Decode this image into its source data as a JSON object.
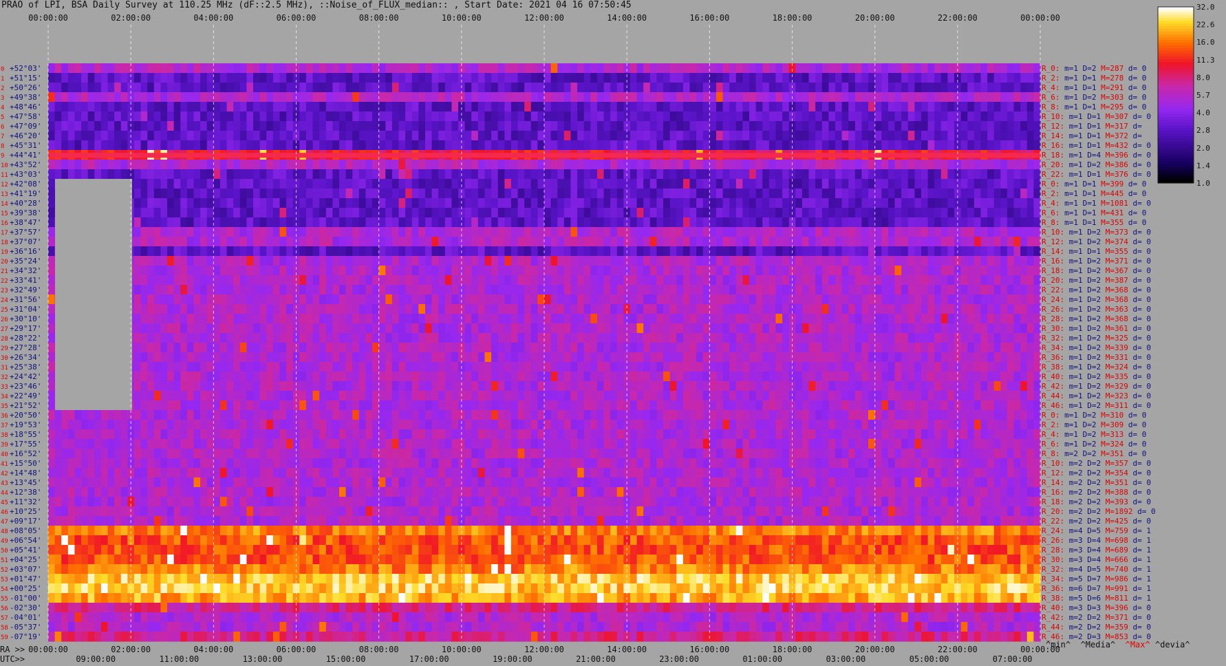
{
  "title": "PRAO of LPI, BSA Daily Survey at 110.25 MHz (dF::2.5 MHz), ::Noise_of_FLUX_median:: , Start Date: 2021 04 16 07:50:45",
  "colors": {
    "background": "#a5a5a5",
    "beam_label": "#e00000",
    "dec_label": "#101080",
    "stat_label": "#101080"
  },
  "legend_bottom": {
    "min": "^min^",
    "median": "^Media^",
    "max": "^Max^",
    "dev": "^devia^"
  },
  "ra_prefix": "RA >>",
  "utc_prefix": "UTC>>",
  "chart_data": {
    "type": "heatmap",
    "title": "PRAO of LPI, BSA Daily Survey at 110.25 MHz (dF::2.5 MHz), ::Noise_of_FLUX_median:: , Start Date: 2021 04 16 07:50:45",
    "x_top_ticks": [
      "00:00:00",
      "02:00:00",
      "04:00:00",
      "06:00:00",
      "08:00:00",
      "10:00:00",
      "12:00:00",
      "14:00:00",
      "16:00:00",
      "18:00:00",
      "20:00:00",
      "22:00:00",
      "00:00:00"
    ],
    "ra_ticks": [
      "00:00:00",
      "02:00:00",
      "04:00:00",
      "06:00:00",
      "08:00:00",
      "10:00:00",
      "12:00:00",
      "14:00:00",
      "16:00:00",
      "18:00:00",
      "20:00:00",
      "22:00:00",
      "00:00:00"
    ],
    "utc_ticks": [
      "09:00:00",
      "11:00:00",
      "13:00:00",
      "15:00:00",
      "17:00:00",
      "19:00:00",
      "21:00:00",
      "23:00:00",
      "01:00:00",
      "03:00:00",
      "05:00:00",
      "07:00:00"
    ],
    "colorbar": {
      "ticks": [
        32.0,
        22.6,
        16.0,
        11.3,
        8.0,
        5.7,
        4.0,
        2.8,
        2.0,
        1.4,
        1.0
      ],
      "scale": "log",
      "range": [
        1.0,
        32.0
      ],
      "palette": "black-blue-purple-red-yellow-white"
    },
    "rows": [
      {
        "n": "0",
        "dec": "+52°03'",
        "beam": "R_0:",
        "m": "1",
        "D": "2",
        "M": "287",
        "d": "0"
      },
      {
        "n": "1",
        "dec": "+51°15'",
        "beam": "R_2:",
        "m": "1",
        "D": "1",
        "M": "278",
        "d": "0"
      },
      {
        "n": "2",
        "dec": "+50°26'",
        "beam": "R_4:",
        "m": "1",
        "D": "1",
        "M": "291",
        "d": "0"
      },
      {
        "n": "3",
        "dec": "+49°38'",
        "beam": "R_6:",
        "m": "1",
        "D": "2",
        "M": "303",
        "d": "0"
      },
      {
        "n": "4",
        "dec": "+48°46'",
        "beam": "R_8:",
        "m": "1",
        "D": "1",
        "M": "295",
        "d": "0"
      },
      {
        "n": "5",
        "dec": "+47°58'",
        "beam": "R_10:",
        "m": "1",
        "D": "1",
        "M": "307",
        "d": "0"
      },
      {
        "n": "6",
        "dec": "+47°09'",
        "beam": "R_12:",
        "m": "1",
        "D": "1",
        "M": "317",
        "d": ""
      },
      {
        "n": "7",
        "dec": "+46°20'",
        "beam": "R_14:",
        "m": "1",
        "D": "1",
        "M": "372",
        "d": ""
      },
      {
        "n": "8",
        "dec": "+45°31'",
        "beam": "R_16:",
        "m": "1",
        "D": "1",
        "M": "432",
        "d": "0"
      },
      {
        "n": "9",
        "dec": "+44°41'",
        "beam": "R_18:",
        "m": "1",
        "D": "4",
        "M": "396",
        "d": "0"
      },
      {
        "n": "10",
        "dec": "+43°52'",
        "beam": "R_20:",
        "m": "1",
        "D": "2",
        "M": "386",
        "d": "0"
      },
      {
        "n": "11",
        "dec": "+43°03'",
        "beam": "R_22:",
        "m": "1",
        "D": "1",
        "M": "376",
        "d": "0"
      },
      {
        "n": "12",
        "dec": "+42°08'",
        "beam": "R_0:",
        "m": "1",
        "D": "1",
        "M": "399",
        "d": "0"
      },
      {
        "n": "13",
        "dec": "+41°19'",
        "beam": "R_2:",
        "m": "1",
        "D": "1",
        "M": "445",
        "d": "0"
      },
      {
        "n": "14",
        "dec": "+40°28'",
        "beam": "R_4:",
        "m": "1",
        "D": "1",
        "M": "1081",
        "d": "0"
      },
      {
        "n": "15",
        "dec": "+39°38'",
        "beam": "R_6:",
        "m": "1",
        "D": "1",
        "M": "431",
        "d": "0"
      },
      {
        "n": "16",
        "dec": "+38°47'",
        "beam": "R_8:",
        "m": "1",
        "D": "1",
        "M": "355",
        "d": "0"
      },
      {
        "n": "17",
        "dec": "+37°57'",
        "beam": "R_10:",
        "m": "1",
        "D": "2",
        "M": "373",
        "d": "0"
      },
      {
        "n": "18",
        "dec": "+37°07'",
        "beam": "R_12:",
        "m": "1",
        "D": "2",
        "M": "374",
        "d": "0"
      },
      {
        "n": "19",
        "dec": "+36°16'",
        "beam": "R_14:",
        "m": "1",
        "D": "1",
        "M": "355",
        "d": "0"
      },
      {
        "n": "20",
        "dec": "+35°24'",
        "beam": "R_16:",
        "m": "1",
        "D": "2",
        "M": "371",
        "d": "0"
      },
      {
        "n": "21",
        "dec": "+34°32'",
        "beam": "R_18:",
        "m": "1",
        "D": "2",
        "M": "367",
        "d": "0"
      },
      {
        "n": "22",
        "dec": "+33°41'",
        "beam": "R_20:",
        "m": "1",
        "D": "2",
        "M": "387",
        "d": "0"
      },
      {
        "n": "23",
        "dec": "+32°49'",
        "beam": "R_22:",
        "m": "1",
        "D": "2",
        "M": "368",
        "d": "0"
      },
      {
        "n": "24",
        "dec": "+31°56'",
        "beam": "R_24:",
        "m": "1",
        "D": "2",
        "M": "368",
        "d": "0"
      },
      {
        "n": "25",
        "dec": "+31°04'",
        "beam": "R_26:",
        "m": "1",
        "D": "2",
        "M": "363",
        "d": "0"
      },
      {
        "n": "26",
        "dec": "+30°10'",
        "beam": "R_28:",
        "m": "1",
        "D": "2",
        "M": "368",
        "d": "0"
      },
      {
        "n": "27",
        "dec": "+29°17'",
        "beam": "R_30:",
        "m": "1",
        "D": "2",
        "M": "361",
        "d": "0"
      },
      {
        "n": "28",
        "dec": "+28°22'",
        "beam": "R_32:",
        "m": "1",
        "D": "2",
        "M": "325",
        "d": "0"
      },
      {
        "n": "29",
        "dec": "+27°28'",
        "beam": "R_34:",
        "m": "1",
        "D": "2",
        "M": "339",
        "d": "0"
      },
      {
        "n": "30",
        "dec": "+26°34'",
        "beam": "R_36:",
        "m": "1",
        "D": "2",
        "M": "331",
        "d": "0"
      },
      {
        "n": "31",
        "dec": "+25°38'",
        "beam": "R_38:",
        "m": "1",
        "D": "2",
        "M": "324",
        "d": "0"
      },
      {
        "n": "32",
        "dec": "+24°42'",
        "beam": "R_40:",
        "m": "1",
        "D": "2",
        "M": "335",
        "d": "0"
      },
      {
        "n": "33",
        "dec": "+23°46'",
        "beam": "R_42:",
        "m": "1",
        "D": "2",
        "M": "329",
        "d": "0"
      },
      {
        "n": "34",
        "dec": "+22°49'",
        "beam": "R_44:",
        "m": "1",
        "D": "2",
        "M": "323",
        "d": "0"
      },
      {
        "n": "35",
        "dec": "+21°52'",
        "beam": "R_46:",
        "m": "1",
        "D": "2",
        "M": "311",
        "d": "0"
      },
      {
        "n": "36",
        "dec": "+20°50'",
        "beam": "R_0:",
        "m": "1",
        "D": "2",
        "M": "310",
        "d": "0"
      },
      {
        "n": "37",
        "dec": "+19°53'",
        "beam": "R_2:",
        "m": "1",
        "D": "2",
        "M": "309",
        "d": "0"
      },
      {
        "n": "38",
        "dec": "+18°55'",
        "beam": "R_4:",
        "m": "1",
        "D": "2",
        "M": "313",
        "d": "0"
      },
      {
        "n": "39",
        "dec": "+17°55'",
        "beam": "R_6:",
        "m": "1",
        "D": "2",
        "M": "324",
        "d": "0"
      },
      {
        "n": "40",
        "dec": "+16°52'",
        "beam": "R_8:",
        "m": "2",
        "D": "2",
        "M": "351",
        "d": "0"
      },
      {
        "n": "41",
        "dec": "+15°50'",
        "beam": "R_10:",
        "m": "2",
        "D": "2",
        "M": "357",
        "d": "0"
      },
      {
        "n": "42",
        "dec": "+14°48'",
        "beam": "R_12:",
        "m": "2",
        "D": "2",
        "M": "354",
        "d": "0"
      },
      {
        "n": "43",
        "dec": "+13°45'",
        "beam": "R_14:",
        "m": "2",
        "D": "2",
        "M": "351",
        "d": "0"
      },
      {
        "n": "44",
        "dec": "+12°38'",
        "beam": "R_16:",
        "m": "2",
        "D": "2",
        "M": "388",
        "d": "0"
      },
      {
        "n": "45",
        "dec": "+11°32'",
        "beam": "R_18:",
        "m": "2",
        "D": "2",
        "M": "393",
        "d": "0"
      },
      {
        "n": "46",
        "dec": "+10°25'",
        "beam": "R_20:",
        "m": "2",
        "D": "2",
        "M": "1892",
        "d": "0"
      },
      {
        "n": "47",
        "dec": "+09°17'",
        "beam": "R_22:",
        "m": "2",
        "D": "2",
        "M": "425",
        "d": "0"
      },
      {
        "n": "48",
        "dec": "+08°05'",
        "beam": "R_24:",
        "m": "4",
        "D": "5",
        "M": "759",
        "d": "1"
      },
      {
        "n": "49",
        "dec": "+06°54'",
        "beam": "R_26:",
        "m": "3",
        "D": "4",
        "M": "698",
        "d": "1"
      },
      {
        "n": "50",
        "dec": "+05°41'",
        "beam": "R_28:",
        "m": "3",
        "D": "4",
        "M": "689",
        "d": "1"
      },
      {
        "n": "51",
        "dec": "+04°25'",
        "beam": "R_30:",
        "m": "3",
        "D": "4",
        "M": "666",
        "d": "1"
      },
      {
        "n": "52",
        "dec": "+03°07'",
        "beam": "R_32:",
        "m": "4",
        "D": "5",
        "M": "740",
        "d": "1"
      },
      {
        "n": "53",
        "dec": "+01°47'",
        "beam": "R_34:",
        "m": "5",
        "D": "7",
        "M": "986",
        "d": "1"
      },
      {
        "n": "54",
        "dec": "+00°25'",
        "beam": "R_36:",
        "m": "6",
        "D": "7",
        "M": "991",
        "d": "1"
      },
      {
        "n": "55",
        "dec": "-01°00'",
        "beam": "R_38:",
        "m": "5",
        "D": "6",
        "M": "811",
        "d": "1"
      },
      {
        "n": "56",
        "dec": "-02°30'",
        "beam": "R_40:",
        "m": "3",
        "D": "3",
        "M": "396",
        "d": "0"
      },
      {
        "n": "57",
        "dec": "-04°01'",
        "beam": "R_42:",
        "m": "2",
        "D": "2",
        "M": "371",
        "d": "0"
      },
      {
        "n": "58",
        "dec": "-05°37'",
        "beam": "R_44:",
        "m": "2",
        "D": "2",
        "M": "359",
        "d": "0"
      },
      {
        "n": "59",
        "dec": "-07°19'",
        "beam": "R_46:",
        "m": "2",
        "D": "3",
        "M": "853",
        "d": "0"
      }
    ]
  }
}
